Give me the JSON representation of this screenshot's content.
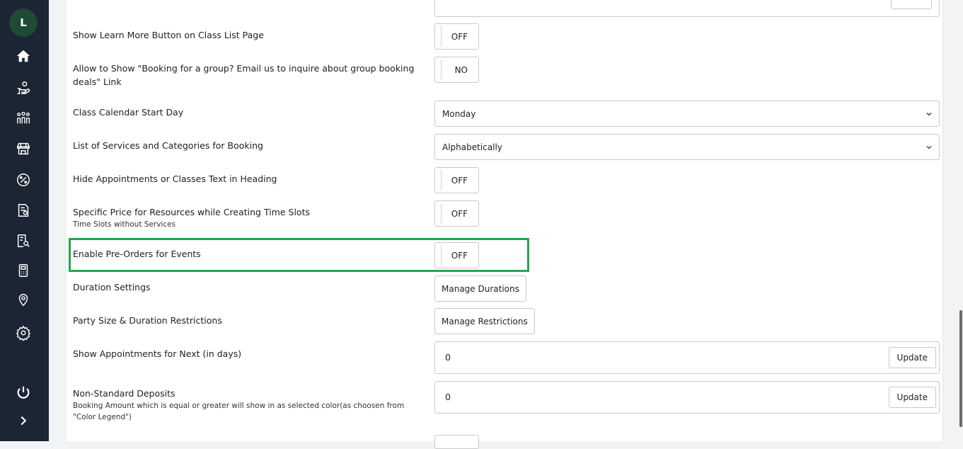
{
  "sidebar": {
    "avatar_initial": "L",
    "icons": [
      "home-icon",
      "hand-coins-icon",
      "group-users-icon",
      "storefront-icon",
      "percent-discount-icon",
      "invoice-icon",
      "report-search-icon",
      "pos-terminal-icon",
      "location-pin-icon",
      "gear-icon",
      "power-icon",
      "chevron-right-icon"
    ]
  },
  "settings": {
    "show_learn_more": {
      "label": "Show Learn More Button on Class List Page",
      "value": "OFF"
    },
    "group_booking_link": {
      "label": "Allow to Show \"Booking for a group? Email us to inquire about group booking deals\" Link",
      "value": "NO"
    },
    "calendar_start_day": {
      "label": "Class Calendar Start Day",
      "value": "Monday"
    },
    "services_list": {
      "label": "List of Services and Categories for Booking",
      "value": "Alphabetically"
    },
    "hide_heading_text": {
      "label": "Hide Appointments or Classes Text in Heading",
      "value": "OFF"
    },
    "specific_price": {
      "label": "Specific Price for Resources while Creating Time Slots",
      "sublabel": "Time Slots without Services",
      "value": "OFF"
    },
    "pre_orders": {
      "label": "Enable Pre-Orders for Events",
      "value": "OFF"
    },
    "duration_settings": {
      "label": "Duration Settings",
      "button": "Manage Durations"
    },
    "party_size": {
      "label": "Party Size & Duration Restrictions",
      "button": "Manage Restrictions"
    },
    "show_appointments_next": {
      "label": "Show Appointments for Next (in days)",
      "value": "0",
      "button": "Update"
    },
    "non_standard_deposits": {
      "label": "Non-Standard Deposits",
      "sublabel": "Booking Amount which is equal or greater will show in as selected color(as choosen from \"Color Legend\")",
      "value": "0",
      "button": "Update"
    }
  },
  "colors": {
    "sidebar_bg": "#1b2533",
    "highlight": "#23a846",
    "avatar_bg": "#1f4a34"
  }
}
